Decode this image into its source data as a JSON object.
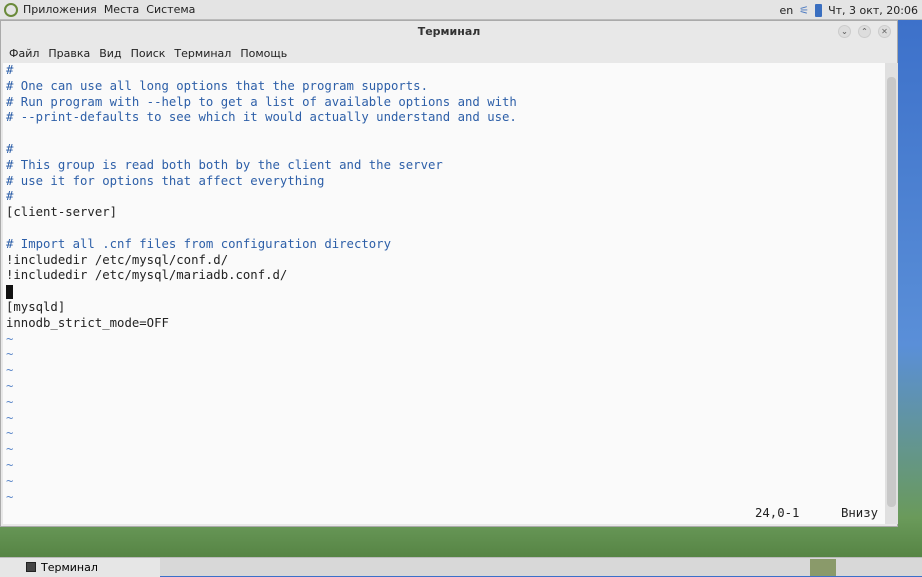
{
  "topbar": {
    "menus": [
      "Приложения",
      "Места",
      "Система"
    ],
    "lang": "en",
    "clock": "Чт, 3 окт, 20:06"
  },
  "window": {
    "title": "Терминал",
    "menu": [
      "Файл",
      "Правка",
      "Вид",
      "Поиск",
      "Терминал",
      "Помощь"
    ]
  },
  "terminal": {
    "lines": [
      {
        "t": "#",
        "k": "c"
      },
      {
        "t": "# One can use all long options that the program supports.",
        "k": "c"
      },
      {
        "t": "# Run program with --help to get a list of available options and with",
        "k": "c"
      },
      {
        "t": "# --print-defaults to see which it would actually understand and use.",
        "k": "c"
      },
      {
        "t": "",
        "k": ""
      },
      {
        "t": "#",
        "k": "c"
      },
      {
        "t": "# This group is read both both by the client and the server",
        "k": "c"
      },
      {
        "t": "# use it for options that affect everything",
        "k": "c"
      },
      {
        "t": "#",
        "k": "c"
      },
      {
        "t": "[client-server]",
        "k": ""
      },
      {
        "t": "",
        "k": ""
      },
      {
        "t": "# Import all .cnf files from configuration directory",
        "k": "c"
      },
      {
        "t": "!includedir /etc/mysql/conf.d/",
        "k": ""
      },
      {
        "t": "!includedir /etc/mysql/mariadb.conf.d/",
        "k": ""
      },
      {
        "t": "",
        "k": "cursor"
      },
      {
        "t": "[mysqld]",
        "k": ""
      },
      {
        "t": "innodb_strict_mode=OFF",
        "k": ""
      },
      {
        "t": "~",
        "k": "tilde"
      },
      {
        "t": "~",
        "k": "tilde"
      },
      {
        "t": "~",
        "k": "tilde"
      },
      {
        "t": "~",
        "k": "tilde"
      },
      {
        "t": "~",
        "k": "tilde"
      },
      {
        "t": "~",
        "k": "tilde"
      },
      {
        "t": "~",
        "k": "tilde"
      },
      {
        "t": "~",
        "k": "tilde"
      },
      {
        "t": "~",
        "k": "tilde"
      },
      {
        "t": "~",
        "k": "tilde"
      },
      {
        "t": "~",
        "k": "tilde"
      }
    ],
    "status_pos": "24,0-1",
    "status_where": "Внизу"
  },
  "taskbar": {
    "task": "Терминал"
  }
}
